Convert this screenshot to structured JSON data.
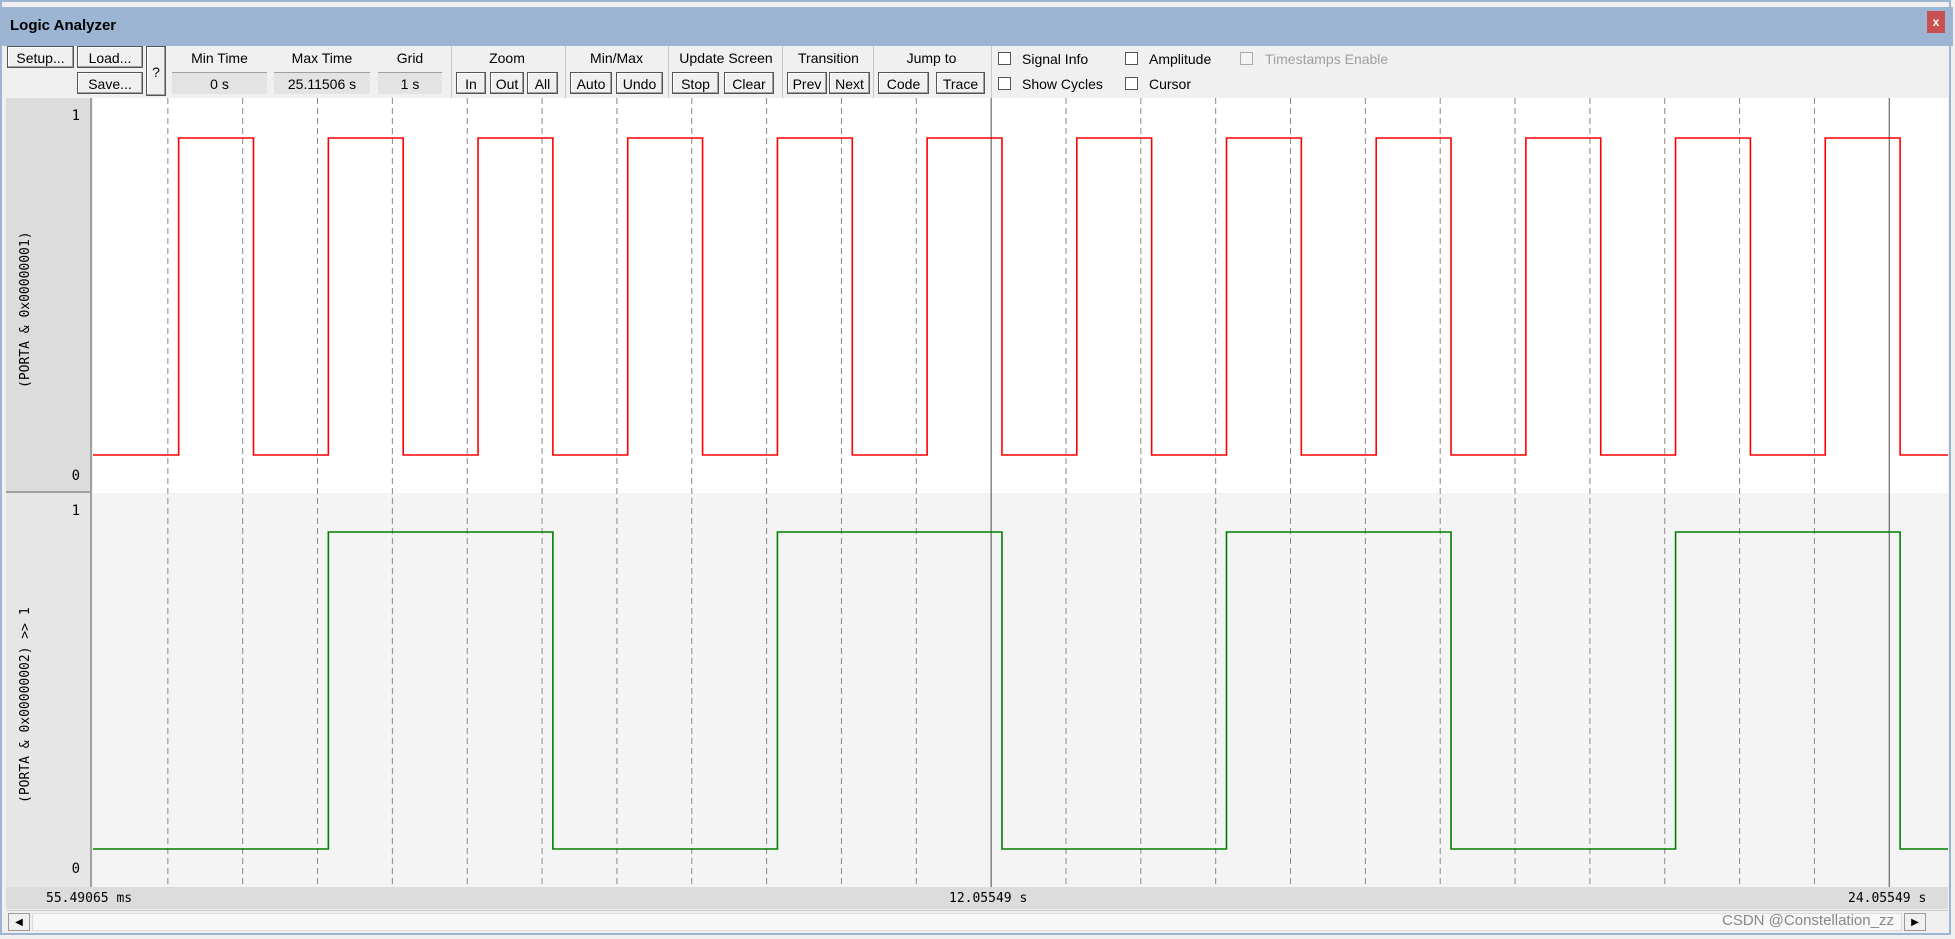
{
  "window": {
    "title": "Logic Analyzer",
    "close_label": "x"
  },
  "toolbar": {
    "setup": "Setup...",
    "load": "Load...",
    "save": "Save...",
    "help": "?",
    "min_time": {
      "label": "Min Time",
      "value": "0 s"
    },
    "max_time": {
      "label": "Max Time",
      "value": "25.11506 s"
    },
    "grid": {
      "label": "Grid",
      "value": "1 s"
    },
    "zoom": {
      "label": "Zoom",
      "in": "In",
      "out": "Out",
      "all": "All"
    },
    "minmax": {
      "label": "Min/Max",
      "auto": "Auto",
      "undo": "Undo"
    },
    "update": {
      "label": "Update Screen",
      "stop": "Stop",
      "clear": "Clear"
    },
    "transition": {
      "label": "Transition",
      "prev": "Prev",
      "next": "Next"
    },
    "jump": {
      "label": "Jump to",
      "code": "Code",
      "trace": "Trace"
    },
    "checkboxes": {
      "signal_info": {
        "label": "Signal Info",
        "checked": false
      },
      "amplitude": {
        "label": "Amplitude",
        "checked": false
      },
      "timestamps": {
        "label": "Timestamps Enable",
        "checked": false,
        "disabled": true
      },
      "show_cycles": {
        "label": "Show Cycles",
        "checked": false
      },
      "cursor": {
        "label": "Cursor",
        "checked": false
      }
    }
  },
  "time_axis": {
    "left": "55.49065 ms",
    "mid": "12.05549 s",
    "right": "24.05549 s"
  },
  "watermark": "CSDN @Constellation_zz",
  "chart_data": {
    "type": "line",
    "x_unit": "s",
    "xlim": [
      0.05549,
      24.84
    ],
    "grid_spacing": 1,
    "grid": true,
    "markers": [
      12.05549,
      24.05549
    ],
    "series": [
      {
        "name": "(PORTA & 0x00000001)",
        "color": "#ff0000",
        "ymax_label": "1",
        "ymin_label": "0",
        "initial": 0,
        "edges": [
          1.2,
          2.2,
          3.2,
          4.2,
          5.2,
          6.2,
          7.2,
          8.2,
          9.2,
          10.2,
          11.2,
          12.2,
          13.2,
          14.2,
          15.2,
          16.2,
          17.2,
          18.2,
          19.2,
          20.2,
          21.2,
          22.2,
          23.2,
          24.2
        ]
      },
      {
        "name": "(PORTA & 0x00000002) >> 1",
        "color": "#008000",
        "ymax_label": "1",
        "ymin_label": "0",
        "initial": 0,
        "edges": [
          3.2,
          6.2,
          9.2,
          12.2,
          15.2,
          18.2,
          21.2,
          24.2
        ]
      }
    ]
  }
}
